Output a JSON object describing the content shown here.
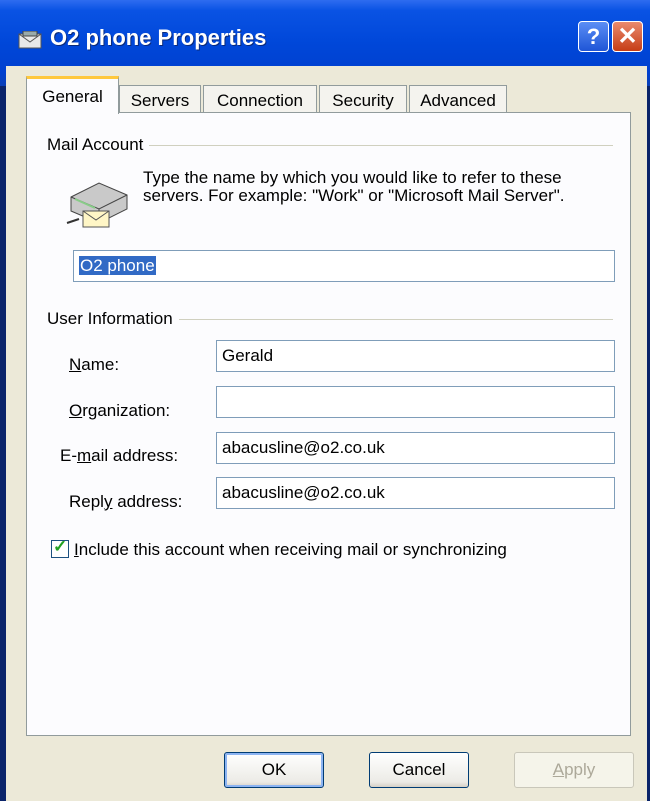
{
  "window": {
    "title": "O2 phone Properties",
    "help_glyph": "?",
    "close_glyph": "✕"
  },
  "tabs": [
    {
      "label": "General"
    },
    {
      "label": "Servers"
    },
    {
      "label": "Connection"
    },
    {
      "label": "Security"
    },
    {
      "label": "Advanced"
    }
  ],
  "mail_account": {
    "group_label": "Mail Account",
    "description": "Type the name by which you would like to refer to these servers.  For example: \"Work\" or \"Microsoft Mail Server\".",
    "account_name": "O2 phone"
  },
  "user_info": {
    "group_label": "User Information",
    "name_label_pre": "",
    "name_label_u": "N",
    "name_label_post": "ame:",
    "name_value": "Gerald",
    "org_label_pre": "",
    "org_label_u": "O",
    "org_label_post": "rganization:",
    "org_value": "",
    "email_label_pre": "E-",
    "email_label_u": "m",
    "email_label_post": "ail address:",
    "email_value": "abacusline@o2.co.uk",
    "reply_label_pre": "Repl",
    "reply_label_u": "y",
    "reply_label_post": " address:",
    "reply_value": "abacusline@o2.co.uk"
  },
  "include_checkbox": {
    "checked": true,
    "mark": "✓",
    "label_u": "I",
    "label_post": "nclude this account when receiving mail or synchronizing"
  },
  "buttons": {
    "ok": "OK",
    "cancel": "Cancel",
    "apply_pre": "",
    "apply_u": "A",
    "apply_post": "pply"
  }
}
